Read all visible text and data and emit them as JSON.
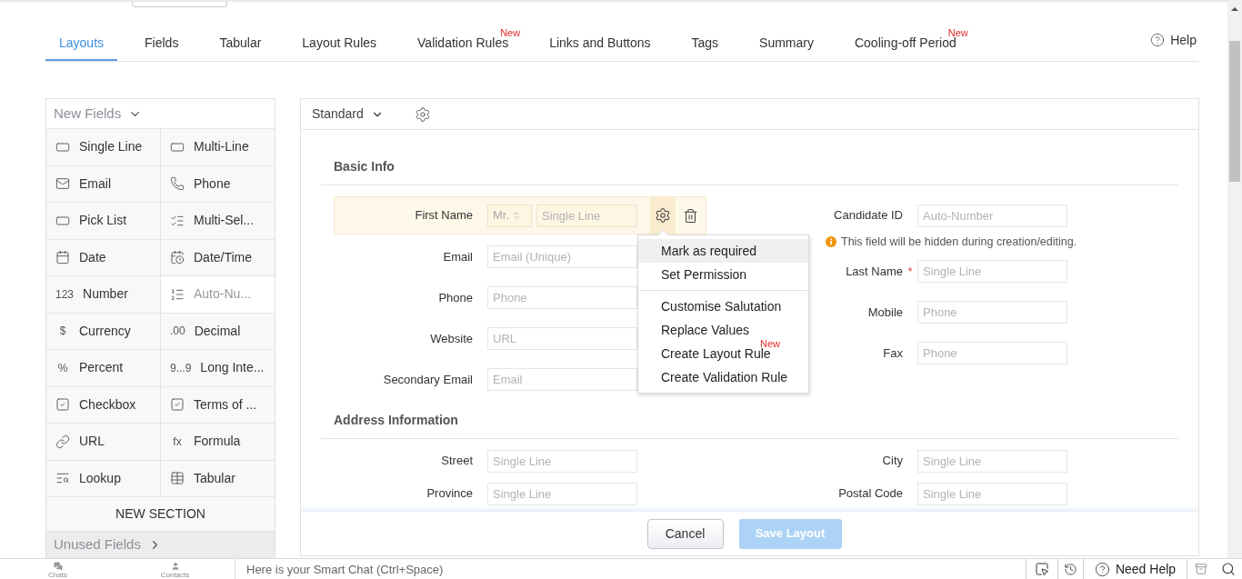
{
  "tabs": [
    {
      "label": "Layouts",
      "selected": true
    },
    {
      "label": "Fields",
      "selected": false
    },
    {
      "label": "Tabular",
      "selected": false
    },
    {
      "label": "Layout Rules",
      "selected": false
    },
    {
      "label": "Validation Rules",
      "selected": false,
      "badge": "New"
    },
    {
      "label": "Links and Buttons",
      "selected": false
    },
    {
      "label": "Tags",
      "selected": false
    },
    {
      "label": "Summary",
      "selected": false
    },
    {
      "label": "Cooling-off Period",
      "selected": false,
      "badge": "New"
    }
  ],
  "help": "Help",
  "new_fields": {
    "title": "New Fields",
    "items": [
      {
        "label": "Single Line",
        "disabled": false
      },
      {
        "label": "Multi-Line",
        "disabled": false
      },
      {
        "label": "Email",
        "disabled": false
      },
      {
        "label": "Phone",
        "disabled": false
      },
      {
        "label": "Pick List",
        "disabled": false
      },
      {
        "label": "Multi-Sel...",
        "disabled": false
      },
      {
        "label": "Date",
        "disabled": false
      },
      {
        "label": "Date/Time",
        "disabled": false
      },
      {
        "label": "Number",
        "glyph": "123",
        "disabled": false
      },
      {
        "label": "Auto-Nu...",
        "disabled": true
      },
      {
        "label": "Currency",
        "glyph": "$",
        "disabled": false
      },
      {
        "label": "Decimal",
        "glyph": ".00",
        "disabled": false
      },
      {
        "label": "Percent",
        "glyph": "%",
        "disabled": false
      },
      {
        "label": "Long Inte...",
        "glyph": "9...9",
        "disabled": false
      },
      {
        "label": "Checkbox",
        "disabled": false
      },
      {
        "label": "Terms of ...",
        "disabled": false
      },
      {
        "label": "URL",
        "disabled": false
      },
      {
        "label": "Formula",
        "glyph": "fx",
        "disabled": false
      },
      {
        "label": "Lookup",
        "disabled": false
      },
      {
        "label": "Tabular",
        "disabled": false
      }
    ],
    "new_section": "NEW SECTION",
    "unused_fields": "Unused Fields"
  },
  "layout": {
    "name": "Standard"
  },
  "sections": [
    {
      "title": "Basic Info",
      "left": [
        {
          "label": "First Name",
          "placeholder": "Single Line",
          "salutation": "Mr.",
          "active": true
        },
        {
          "label": "Email",
          "placeholder": "Email (Unique)",
          "active": false
        },
        {
          "label": "Phone",
          "placeholder": "Phone",
          "active": false
        },
        {
          "label": "Website",
          "placeholder": "URL",
          "active": false
        },
        {
          "label": "Secondary Email",
          "placeholder": "Email",
          "active": false
        }
      ],
      "right": [
        {
          "label": "Candidate ID",
          "placeholder": "Auto-Number",
          "active": false,
          "note": "This field will be hidden during creation/editing."
        },
        {
          "label": "Last Name",
          "placeholder": "Single Line",
          "active": false,
          "required_mark": "*"
        },
        {
          "label": "Mobile",
          "placeholder": "Phone",
          "active": false
        },
        {
          "label": "Fax",
          "placeholder": "Phone",
          "active": false
        }
      ]
    },
    {
      "title": "Address Information",
      "left": [
        {
          "label": "Street",
          "placeholder": "Single Line",
          "active": false
        },
        {
          "label": "Province",
          "placeholder": "Single Line",
          "active": false
        }
      ],
      "right": [
        {
          "label": "City",
          "placeholder": "Single Line",
          "active": false
        },
        {
          "label": "Postal Code",
          "placeholder": "Single Line",
          "active": false
        }
      ]
    }
  ],
  "menu": {
    "groups": [
      [
        {
          "label": "Mark as required",
          "selected": true
        },
        {
          "label": "Set Permission",
          "selected": false
        }
      ],
      [
        {
          "label": "Customise Salutation",
          "selected": false
        },
        {
          "label": "Replace Values",
          "selected": false
        },
        {
          "label": "Create Layout Rule",
          "selected": false,
          "badge": "New"
        },
        {
          "label": "Create Validation Rule",
          "selected": false
        }
      ]
    ]
  },
  "buttons": {
    "cancel": "Cancel",
    "save": {
      "label": "Save Layout",
      "disabled": true
    }
  },
  "bottom_bar": {
    "chats": "Chats",
    "contacts": "Contacts",
    "smart_chat": {
      "placeholder": "Here is your Smart Chat (Ctrl+Space)"
    },
    "help": "Need Help"
  }
}
